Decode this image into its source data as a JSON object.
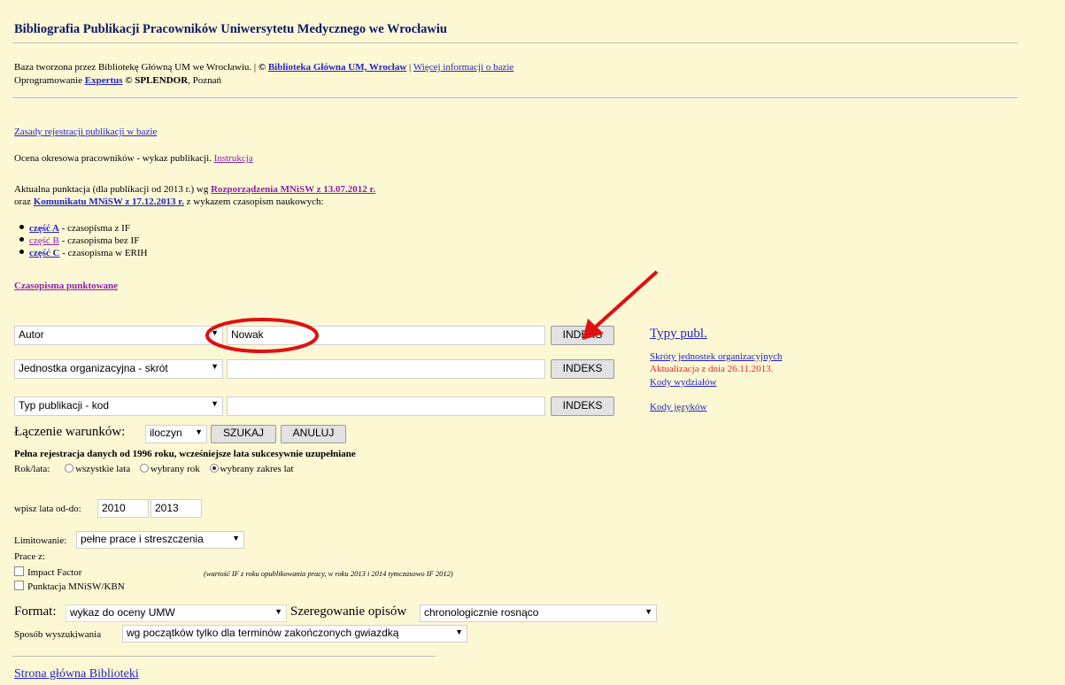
{
  "header": {
    "title": "Bibliografia Publikacji Pracowników Uniwersytetu Medycznego we Wrocławiu",
    "base_text": "Baza tworzona przez Bibliotekę Główną UM we Wrocławiu. |",
    "copyright": "©",
    "library_link": "Biblioteka Główna UM, Wrocław",
    "separator": "|",
    "more_info_link": "Więcej informacji o bazie",
    "software_prefix": "Oprogramowanie",
    "software_link": "Expertus",
    "software_suffix": "© SPLENDOR",
    "software_city": ", Poznań"
  },
  "info": {
    "rules_link": "Zasady rejestracji publikacji w bazie",
    "assessment_text": "Ocena okresowa pracowników - wykaz publikacji.",
    "instruction_link": "Instrukcja",
    "points_text_1": "Aktualna punktacja (dla publikacji od 2013 r.) wg",
    "points_link_1": "Rozporządzenia MNiSW z 13.07.2012 r.",
    "points_text_2": "oraz",
    "points_link_2": "Komunikatu MNiSW z 17.12.2013 r.",
    "points_text_3": "z wykazem czasopism naukowych:",
    "parts": [
      {
        "link": "część A",
        "text": " - czasopisma z IF"
      },
      {
        "link": "część B",
        "text": " - czasopisma bez IF"
      },
      {
        "link": "część C",
        "text": " - czasopisma w ERIH"
      }
    ],
    "journals_link": "Czasopisma punktowane"
  },
  "search": {
    "rows": [
      {
        "field": "Autor",
        "value": "Nowak",
        "button": "INDEKS"
      },
      {
        "field": "Jednostka organizacyjna - skrót",
        "value": "",
        "button": "INDEKS"
      },
      {
        "field": "Typ publikacji - kod",
        "value": "",
        "button": "INDEKS"
      }
    ],
    "combine_label": "Łączenie warunków:",
    "combine_value": "iloczyn",
    "search_button": "SZUKAJ",
    "cancel_button": "ANULUJ",
    "full_reg_text": "Pełna rejestracja danych od 1996 roku, wcześniejsze lata sukcesywnie uzupełniane",
    "year_label": "Rok/lata:",
    "year_options": [
      "wszystkie lata",
      "wybrany rok",
      "wybrany zakres lat"
    ],
    "year_selected": 2,
    "range_label": "wpisz lata od-do:",
    "year_from": "2010",
    "year_to": "2013",
    "limit_label": "Limitowanie:",
    "limit_value": "pełne prace i streszczenia",
    "prace_label": "Prace z:",
    "impact_factor": "Impact Factor",
    "if_note": "(wartość IF z roku opublikowania pracy, w roku 2013 i 2014 tymczasowo IF 2012)",
    "mnisw": "Punktacja MNiSW/KBN",
    "format_label": "Format:",
    "format_value": "wykaz do oceny UMW",
    "sort_label": "Szeregowanie opisów",
    "sort_value": "chronologicznie rosnąco",
    "mode_label": "Sposób wyszukiwania",
    "mode_value": "wg początków tylko dla terminów zakończonych gwiazdką"
  },
  "side": {
    "types_link": "Typy publ.",
    "units_link": "Skróty jednostek organizacyjnych",
    "update_text": "Aktualizacja z dnia 26.11.2013.",
    "faculties_link": "Kody wydziałów",
    "languages_link": "Kody języków"
  },
  "footer": {
    "home_link": "Strona główna Biblioteki"
  },
  "annotation": {
    "circle_color": "#e01010",
    "arrow_color": "#e01010"
  }
}
